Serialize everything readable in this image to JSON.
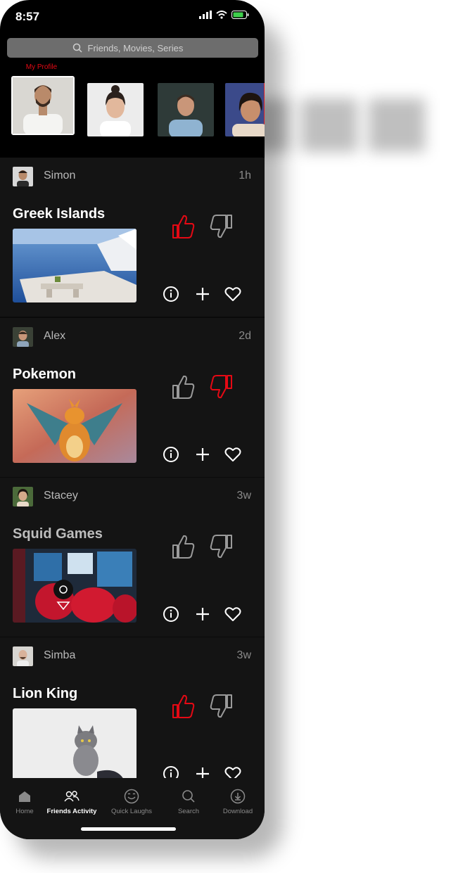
{
  "status": {
    "time": "8:57"
  },
  "search": {
    "placeholder": "Friends, Movies, Series"
  },
  "stories": {
    "my_profile_label": "My Profile"
  },
  "feed": [
    {
      "user": "Simon",
      "time": "1h",
      "title": "Greek Islands",
      "rating": "up"
    },
    {
      "user": "Alex",
      "time": "2d",
      "title": "Pokemon",
      "rating": "down"
    },
    {
      "user": "Stacey",
      "time": "3w",
      "title": "Squid Games",
      "rating": "none"
    },
    {
      "user": "Simba",
      "time": "3w",
      "title": "Lion King",
      "rating": "up"
    }
  ],
  "tabs": [
    {
      "label": "Home",
      "icon": "home-icon"
    },
    {
      "label": "Friends Activity",
      "icon": "friends-icon",
      "active": true
    },
    {
      "label": "Quick Laughs",
      "icon": "smiley-icon"
    },
    {
      "label": "Search",
      "icon": "search-icon"
    },
    {
      "label": "Download",
      "icon": "download-icon"
    }
  ],
  "colors": {
    "accent": "#e50914",
    "background": "#000000",
    "card": "#141414"
  }
}
